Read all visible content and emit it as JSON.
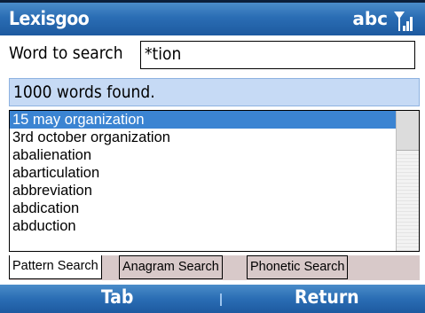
{
  "title_bar": {
    "app_title": "Lexisgoo",
    "input_mode": "abc",
    "signal_icon": "signal-strength-icon"
  },
  "search": {
    "label": "Word to search",
    "value": "*tion"
  },
  "status": {
    "text": "1000 words found."
  },
  "word_list": {
    "items": [
      "15 may organization",
      "3rd october organization",
      "abalienation",
      "abarticulation",
      "abbreviation",
      "abdication",
      "abduction"
    ],
    "selected_index": 0
  },
  "tabs": [
    {
      "label": "Pattern Search",
      "active": true
    },
    {
      "label": "Anagram Search",
      "active": false
    },
    {
      "label": "Phonetic Search",
      "active": false
    }
  ],
  "softkeys": {
    "left": "Tab",
    "right": "Return"
  },
  "colors": {
    "title_bar": "#2a6db4",
    "selection": "#3b84d2",
    "status_bg": "#c6daf5",
    "tab_strip": "#d8c9c9"
  }
}
